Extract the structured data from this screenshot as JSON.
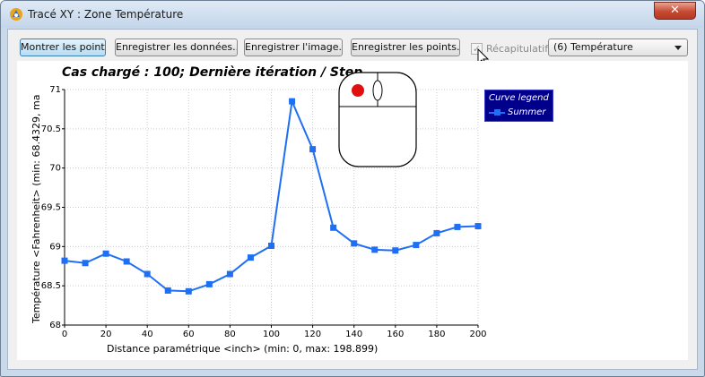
{
  "window": {
    "title": "Tracé XY : Zone Température",
    "close_glyph": "✕"
  },
  "toolbar": {
    "show_points": "Montrer les points",
    "save_data": "Enregistrer les données...",
    "save_image": "Enregistrer l'image...",
    "save_points": "Enregistrer les points...",
    "summary_label": "Récapitulatif",
    "summary_checked": true,
    "variable_select": "(6) Température"
  },
  "colors": {
    "series": "#1f6ff5",
    "legend_bg": "#00008b",
    "mouse_button": "#e01010"
  },
  "icons": {
    "app": "app-logo-icon",
    "cursor": "mouse-pointer-icon",
    "mouse_hint": "mouse-left-click-icon"
  },
  "plot": {
    "title": "Cas chargé : 100; Dernière itération / Step",
    "legend_title": "Curve legend"
  },
  "chart_data": {
    "type": "line",
    "title": "Cas chargé : 100; Dernière itération / Step",
    "xlabel": "Distance paramétrique  <inch> (min: 0, max: 198.899)",
    "ylabel": "Température <Fahrenheit> (min: 68.4329, ma",
    "xlim": [
      0,
      200
    ],
    "ylim": [
      68,
      71
    ],
    "xticks": [
      0,
      20,
      40,
      60,
      80,
      100,
      120,
      140,
      160,
      180,
      200
    ],
    "yticks": [
      68,
      68.5,
      69,
      69.5,
      70,
      70.5,
      71
    ],
    "ytick_labels": [
      "68",
      "68.5",
      "69",
      "69.5",
      "70",
      "70.5",
      "71"
    ],
    "grid": true,
    "legend_position": "top-right",
    "series": [
      {
        "name": "Summer",
        "x": [
          0,
          10,
          20,
          30,
          40,
          50,
          60,
          70,
          80,
          90,
          100,
          110,
          120,
          130,
          140,
          150,
          160,
          170,
          180,
          190,
          200
        ],
        "y": [
          68.82,
          68.79,
          68.91,
          68.81,
          68.65,
          68.44,
          68.43,
          68.52,
          68.65,
          68.86,
          69.01,
          70.85,
          70.24,
          69.24,
          69.04,
          68.96,
          68.95,
          69.02,
          69.17,
          69.25,
          69.26
        ]
      }
    ]
  }
}
